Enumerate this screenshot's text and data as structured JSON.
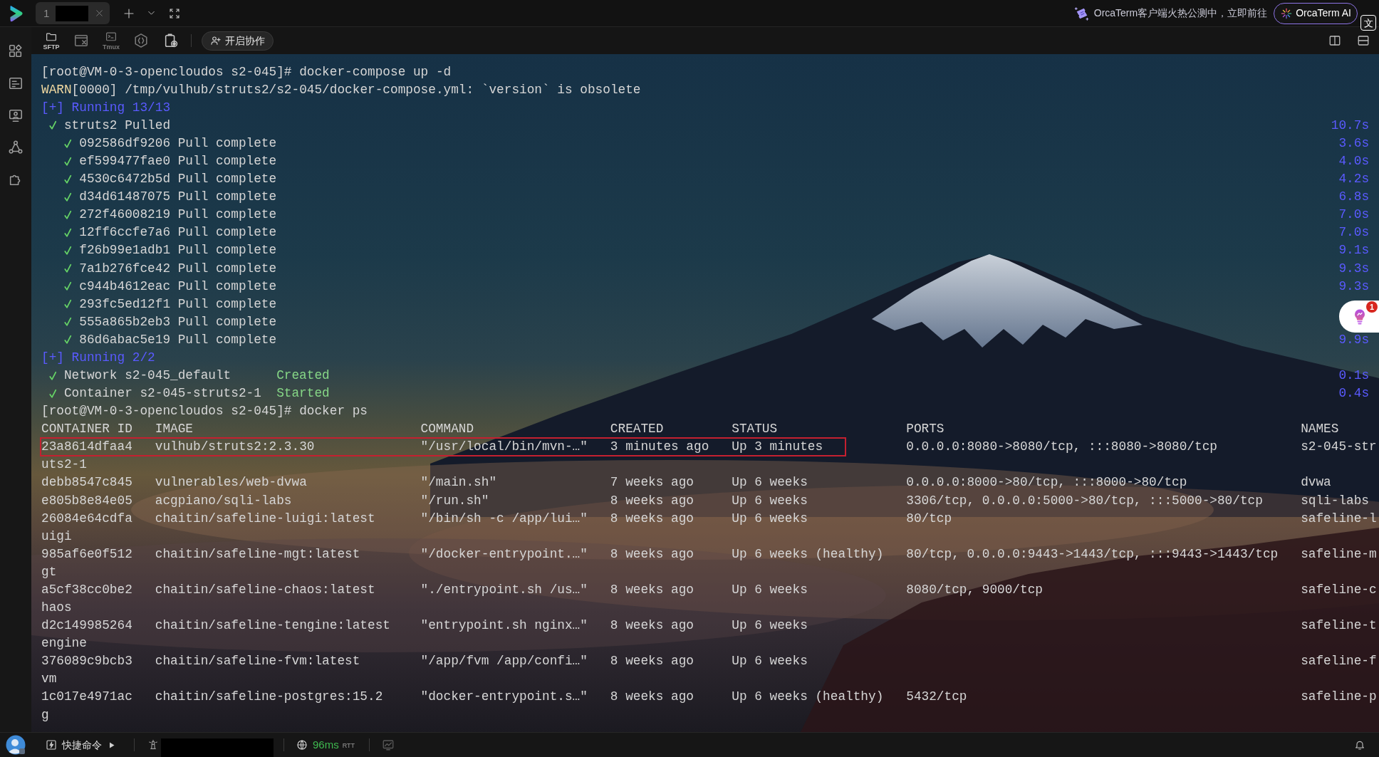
{
  "tab_bar": {
    "tabs": [
      {
        "number": "1",
        "selected": true
      }
    ],
    "promo": {
      "text": "OrcaTerm客户端火热公测中，立即前往"
    },
    "ai_button": {
      "label": "OrcaTerm AI"
    },
    "translate_overlay": {
      "glyph": "文"
    }
  },
  "toolbar": {
    "items": [
      {
        "caption": "SFTP",
        "disabled": false
      },
      {
        "disabled": true
      },
      {
        "caption": "Tmux",
        "disabled": true
      },
      {
        "disabled": true
      },
      {
        "disabled": false
      }
    ],
    "collab_button": {
      "label": "开启协作"
    }
  },
  "terminal": {
    "blocks": [
      {
        "kind": "prompt",
        "text": "[root@VM-0-3-opencloudos s2-045]# docker-compose up -d"
      },
      {
        "kind": "warning",
        "tag": "WARN",
        "text": "[0000] /tmp/vulhub/struts2/s2-045/docker-compose.yml: `version` is obsolete"
      },
      {
        "kind": "progress",
        "text": "[+] Running 13/13",
        "children": [
          {
            "kind": "pull",
            "name": "struts2",
            "status": "Pulled",
            "time": "10.7s",
            "children": [
              {
                "kind": "pull",
                "name": "092586df9206",
                "status": "Pull complete",
                "time": "3.6s"
              },
              {
                "kind": "pull",
                "name": "ef599477fae0",
                "status": "Pull complete",
                "time": "4.0s"
              },
              {
                "kind": "pull",
                "name": "4530c6472b5d",
                "status": "Pull complete",
                "time": "4.2s"
              },
              {
                "kind": "pull",
                "name": "d34d61487075",
                "status": "Pull complete",
                "time": "6.8s"
              },
              {
                "kind": "pull",
                "name": "272f46008219",
                "status": "Pull complete",
                "time": "7.0s"
              },
              {
                "kind": "pull",
                "name": "12ff6ccfe7a6",
                "status": "Pull complete",
                "time": "7.0s"
              },
              {
                "kind": "pull",
                "name": "f26b99e1adb1",
                "status": "Pull complete",
                "time": "9.1s"
              },
              {
                "kind": "pull",
                "name": "7a1b276fce42",
                "status": "Pull complete",
                "time": "9.3s"
              },
              {
                "kind": "pull",
                "name": "c944b4612eac",
                "status": "Pull complete",
                "time": "9.3s"
              },
              {
                "kind": "pull",
                "name": "293fc5ed12f1",
                "status": "Pull complete"
              },
              {
                "kind": "pull",
                "name": "555a865b2eb3",
                "status": "Pull complete"
              },
              {
                "kind": "pull",
                "name": "86d6abac5e19",
                "status": "Pull complete",
                "time": "9.9s"
              }
            ]
          }
        ]
      },
      {
        "kind": "progress",
        "text": "[+] Running 2/2",
        "children": [
          {
            "kind": "create",
            "name": "Network s2-045_default",
            "status": "Created",
            "time": "0.1s"
          },
          {
            "kind": "create",
            "name": "Container s2-045-struts2-1",
            "status": "Started",
            "time": "0.4s"
          }
        ]
      },
      {
        "kind": "prompt",
        "text": "[root@VM-0-3-opencloudos s2-045]# docker ps"
      },
      {
        "kind": "table",
        "columns": [
          "CONTAINER ID",
          "IMAGE",
          "COMMAND",
          "CREATED",
          "STATUS",
          "PORTS",
          "NAMES"
        ],
        "rows": [
          {
            "container_id": "23a8614dfaa4",
            "image": "vulhub/struts2:2.3.30",
            "command": "\"/usr/local/bin/mvn-…\"",
            "created": "3 minutes ago",
            "status": "Up 3 minutes",
            "ports": "0.0.0.0:8080->8080/tcp, :::8080->8080/tcp",
            "names": "s2-045-str",
            "names_wrapped": "uts2-1",
            "highlighted": true
          },
          {
            "container_id": "debb8547c845",
            "image": "vulnerables/web-dvwa",
            "command": "\"/main.sh\"",
            "created": "7 weeks ago",
            "status": "Up 6 weeks",
            "ports": "0.0.0.0:8000->80/tcp, :::8000->80/tcp",
            "names": "dvwa",
            "highlighted": false
          },
          {
            "container_id": "e805b8e84e05",
            "image": "acgpiano/sqli-labs",
            "command": "\"/run.sh\"",
            "created": "8 weeks ago",
            "status": "Up 6 weeks",
            "ports": "3306/tcp, 0.0.0.0:5000->80/tcp, :::5000->80/tcp",
            "names": "sqli-labs",
            "highlighted": false
          },
          {
            "container_id": "26084e64cdfa",
            "image": "chaitin/safeline-luigi:latest",
            "command": "\"/bin/sh -c /app/lui…\"",
            "created": "8 weeks ago",
            "status": "Up 6 weeks",
            "ports": "80/tcp",
            "names": "safeline-l",
            "names_wrapped": "uigi",
            "highlighted": false
          },
          {
            "container_id": "985af6e0f512",
            "image": "chaitin/safeline-mgt:latest",
            "command": "\"/docker-entrypoint.…\"",
            "created": "8 weeks ago",
            "status": "Up 6 weeks (healthy)",
            "ports": "80/tcp, 0.0.0.0:9443->1443/tcp, :::9443->1443/tcp",
            "names": "safeline-m",
            "names_wrapped": "gt",
            "highlighted": false
          },
          {
            "container_id": "a5cf38cc0be2",
            "image": "chaitin/safeline-chaos:latest",
            "command": "\"./entrypoint.sh /us…\"",
            "created": "8 weeks ago",
            "status": "Up 6 weeks",
            "ports": "8080/tcp, 9000/tcp",
            "names": "safeline-c",
            "names_wrapped": "haos",
            "highlighted": false
          },
          {
            "container_id": "d2c149985264",
            "image": "chaitin/safeline-tengine:latest",
            "command": "\"entrypoint.sh nginx…\"",
            "created": "8 weeks ago",
            "status": "Up 6 weeks",
            "names": "safeline-t",
            "names_wrapped": "engine",
            "highlighted": false
          },
          {
            "container_id": "376089c9bcb3",
            "image": "chaitin/safeline-fvm:latest",
            "command": "\"/app/fvm /app/confi…\"",
            "created": "8 weeks ago",
            "status": "Up 6 weeks",
            "names": "safeline-f",
            "names_wrapped": "vm",
            "highlighted": false
          },
          {
            "container_id": "1c017e4971ac",
            "image": "chaitin/safeline-postgres:15.2",
            "command": "\"docker-entrypoint.s…\"",
            "created": "8 weeks ago",
            "status": "Up 6 weeks (healthy)",
            "ports": "5432/tcp",
            "names": "safeline-p",
            "names_wrapped": "g",
            "highlighted": false
          }
        ]
      }
    ]
  },
  "assistant": {
    "badge": "1"
  },
  "status_bar": {
    "quick_commands": {
      "label": "快捷命令"
    },
    "latency": {
      "value": "96ms",
      "unit": "RTT"
    }
  }
}
